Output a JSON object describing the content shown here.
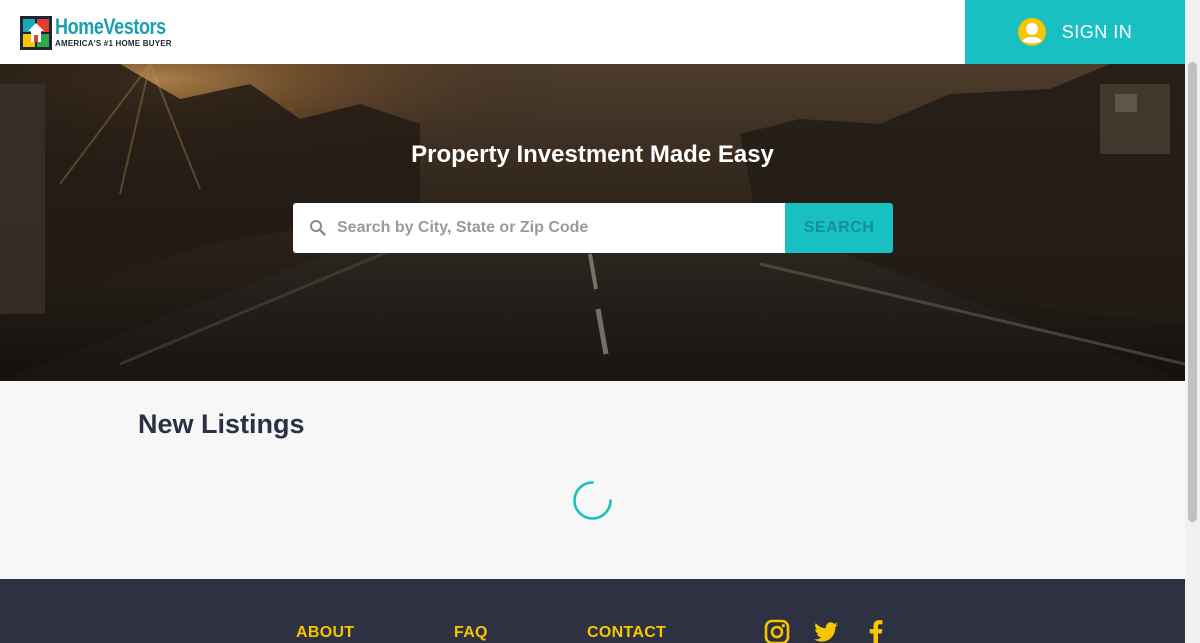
{
  "header": {
    "logo_name": "HomeVestors",
    "logo_tagline": "AMERICA'S #1 HOME BUYER",
    "sign_in_label": "SIGN IN"
  },
  "hero": {
    "title": "Property Investment Made Easy",
    "search_placeholder": "Search by City, State or Zip Code",
    "search_value": "",
    "search_button": "SEARCH"
  },
  "listings": {
    "title": "New Listings"
  },
  "footer": {
    "links": [
      "ABOUT",
      "FAQ",
      "CONTACT"
    ],
    "social_icons": [
      "instagram-icon",
      "twitter-icon",
      "facebook-icon"
    ]
  },
  "colors": {
    "accent": "#18c0c1",
    "footer_bg": "#2e3142",
    "footer_link": "#f7c600",
    "heading": "#2b3145",
    "logo_text": "#1a9fb0"
  }
}
